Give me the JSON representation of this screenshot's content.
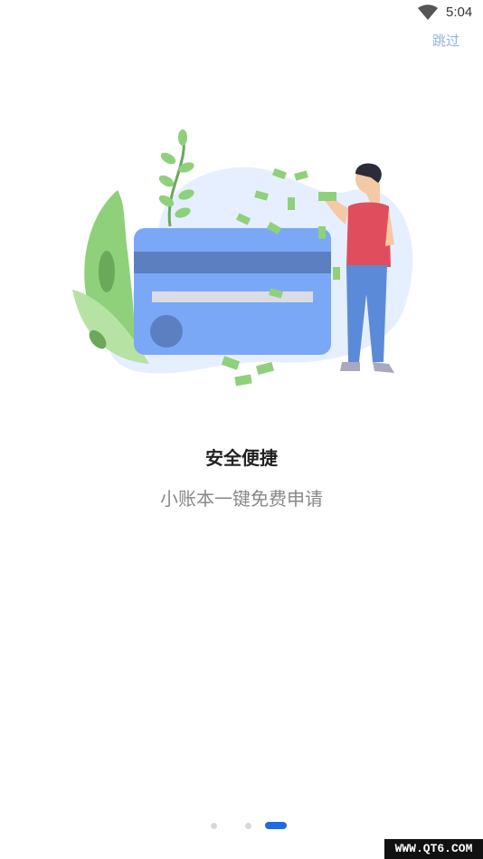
{
  "status_bar": {
    "time": "5:04"
  },
  "header": {
    "skip_label": "跳过"
  },
  "content": {
    "title": "安全便捷",
    "subtitle": "小账本一键免费申请"
  },
  "pager": {
    "count": 3,
    "active_index": 2
  },
  "watermark": {
    "text": "WWW.QT6.COM"
  },
  "colors": {
    "accent": "#1f6be0",
    "skip_text": "#8fb4e2",
    "card": "#7aa8f7",
    "card_stripe": "#5b7fbf",
    "leaf": "#8fd07a",
    "shirt": "#e04e5e",
    "pants": "#5b8bd8"
  }
}
